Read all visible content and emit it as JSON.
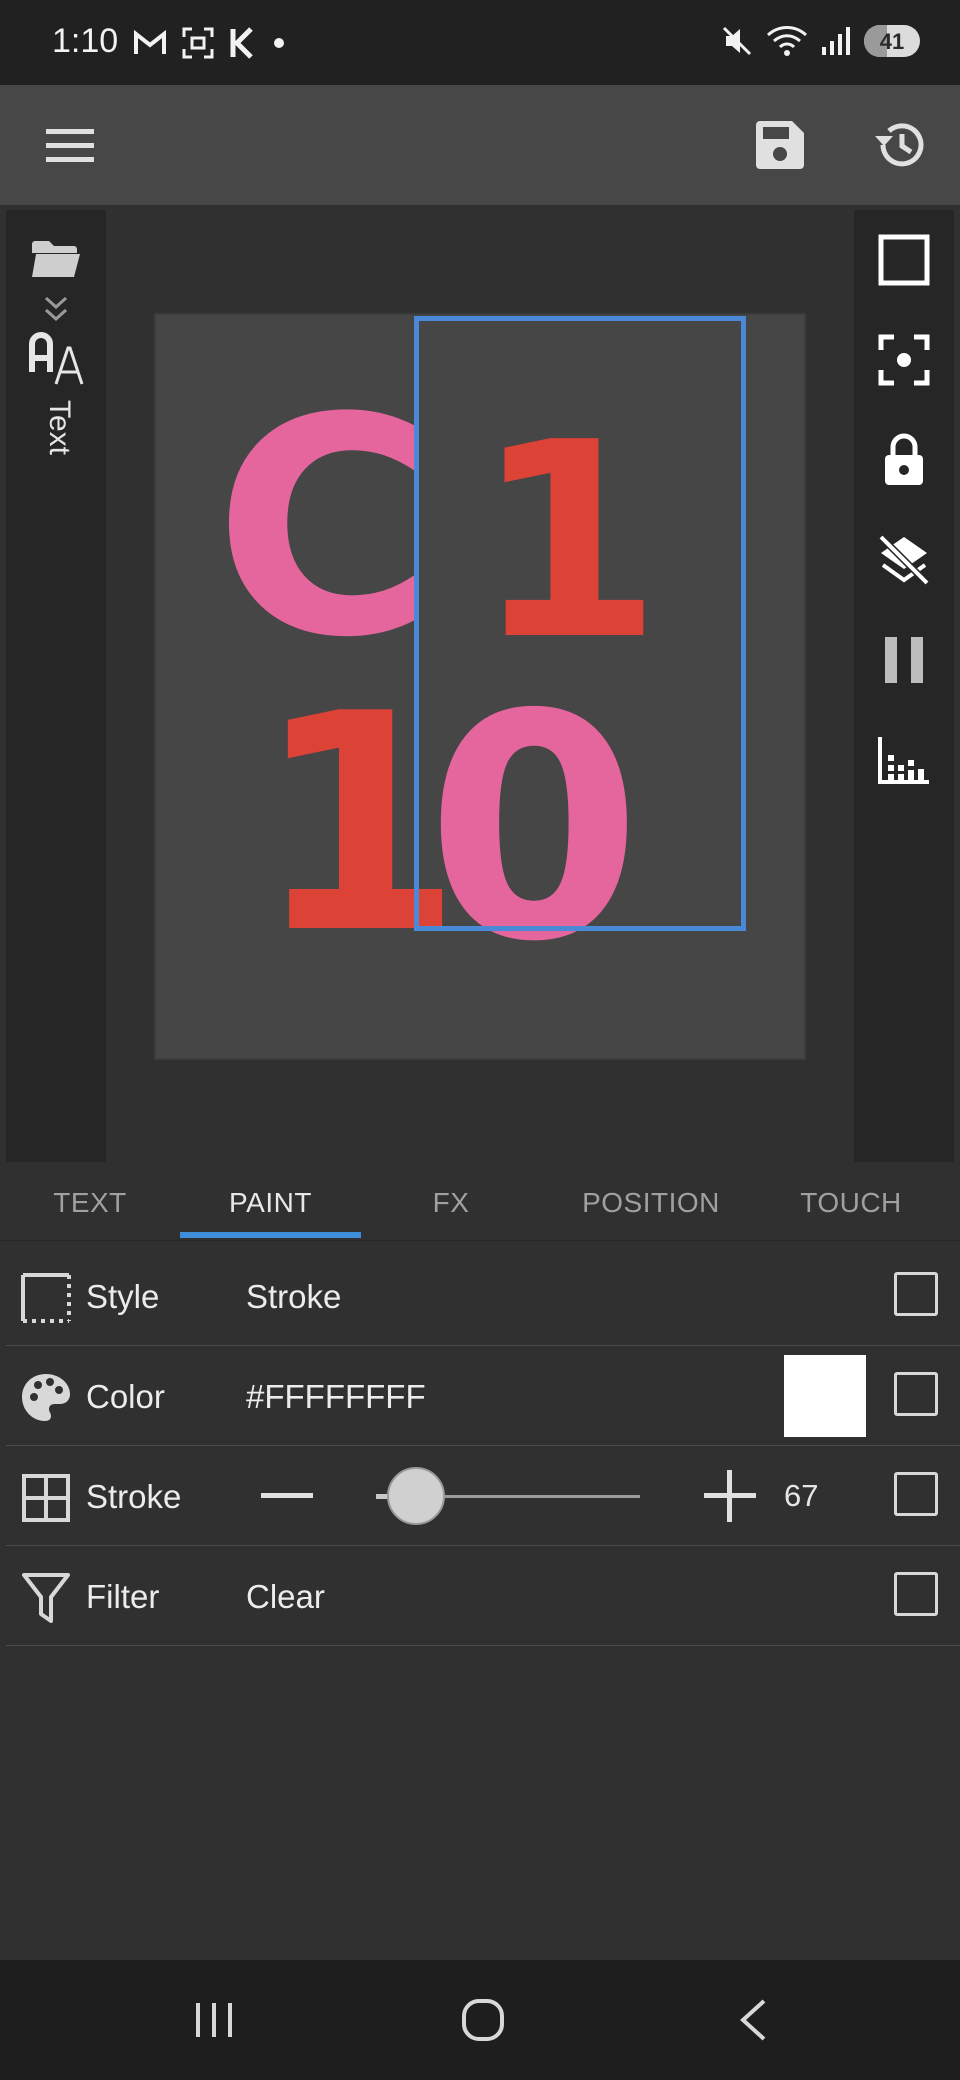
{
  "status": {
    "time": "1:10",
    "battery": "41",
    "battery_level": 0.41
  },
  "app_bar": {
    "menu_icon": "hamburger-menu-icon",
    "save_icon": "save-floppy-icon",
    "history_icon": "history-icon"
  },
  "left_rail": {
    "label": "Text"
  },
  "canvas": {
    "art_top_left": "C",
    "art_top_right": "1",
    "art_bottom_left": "1",
    "art_bottom_right": "0",
    "colors": {
      "pink": "#e5669d",
      "red": "#dc4236",
      "selection": "#4a89d8",
      "canvas_bg": "#464646"
    }
  },
  "tabs": [
    {
      "label": "TEXT"
    },
    {
      "label": "PAINT"
    },
    {
      "label": "FX"
    },
    {
      "label": "POSITION"
    },
    {
      "label": "TOUCH"
    }
  ],
  "active_tab": "PAINT",
  "properties": {
    "style": {
      "label": "Style",
      "value": "Stroke"
    },
    "color": {
      "label": "Color",
      "value": "#FFFFFFFF",
      "swatch": "#FFFFFF"
    },
    "stroke": {
      "label": "Stroke",
      "value": "67",
      "slider_fraction": 0.15
    },
    "filter": {
      "label": "Filter",
      "value": "Clear"
    }
  }
}
